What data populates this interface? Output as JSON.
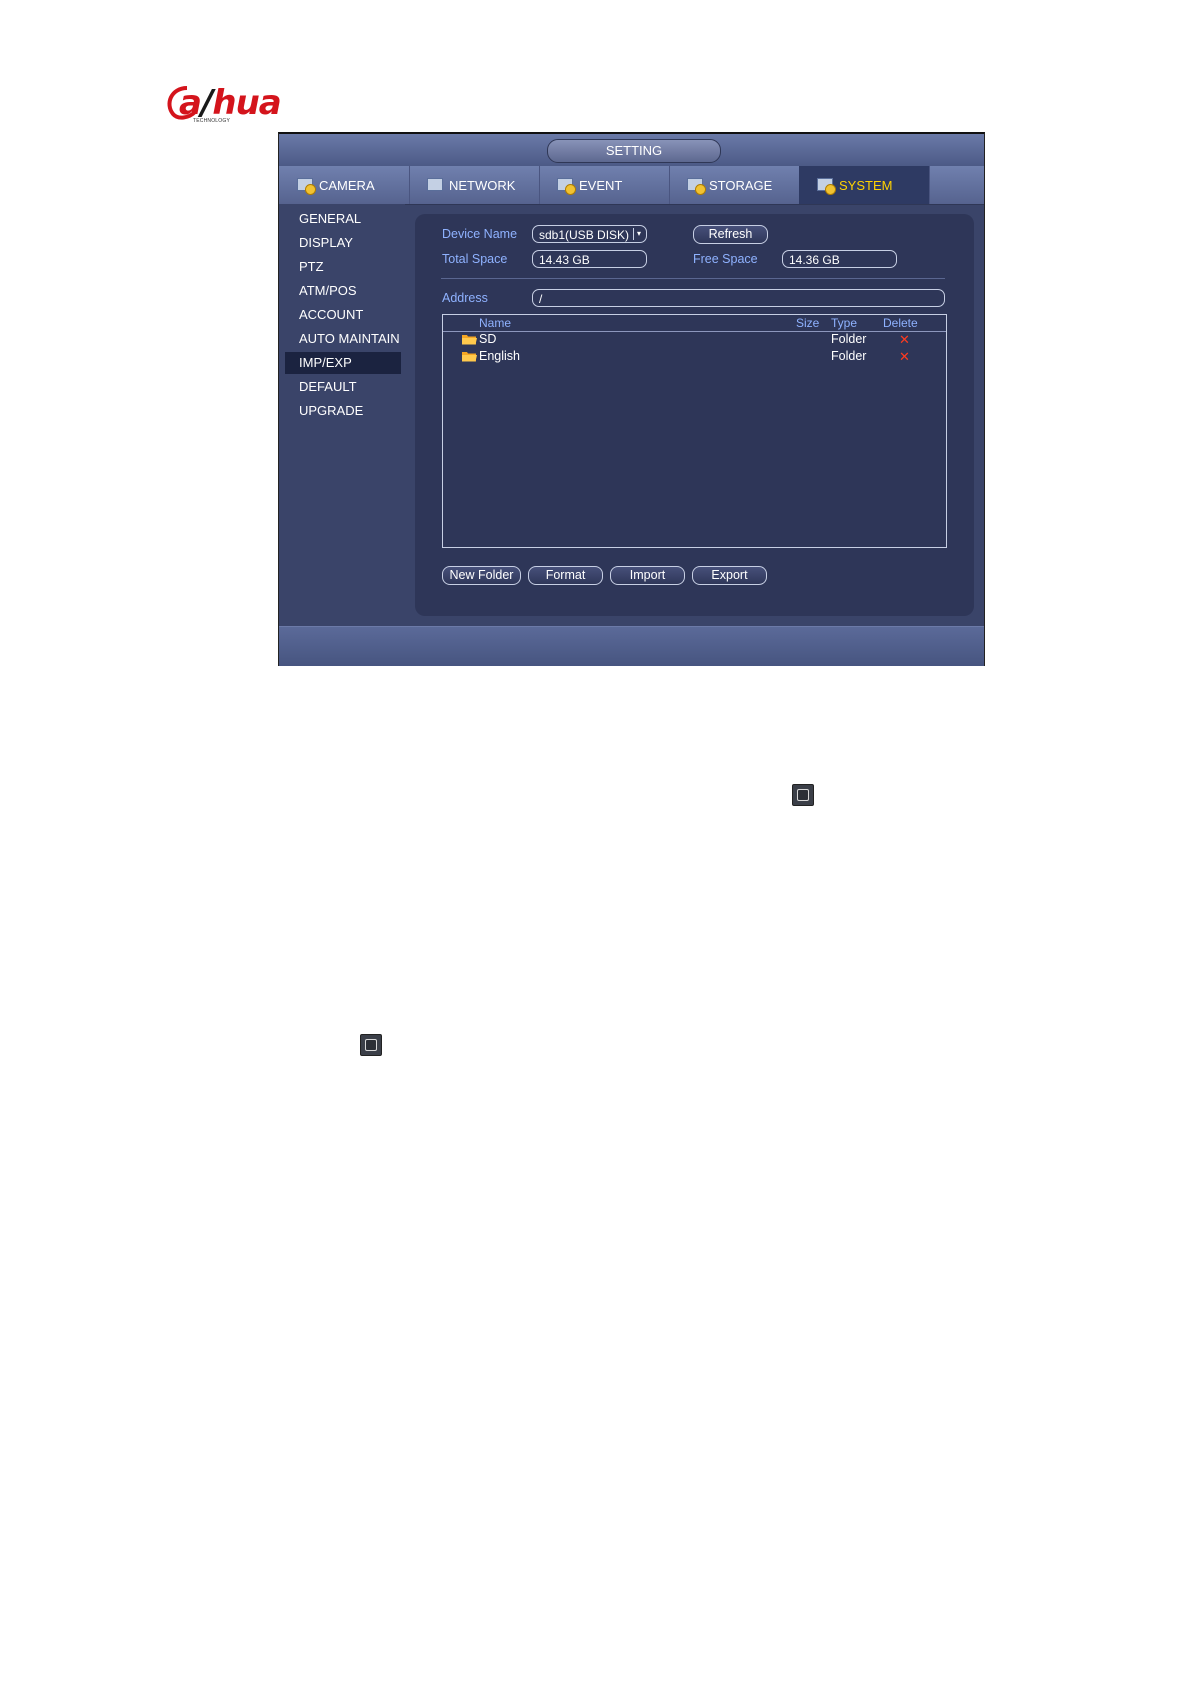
{
  "logo": {
    "brand": "alhua",
    "sub": "TECHNOLOGY"
  },
  "window": {
    "title": "SETTING"
  },
  "tabs": [
    {
      "label": "CAMERA",
      "icon": "camera-icon",
      "active": false
    },
    {
      "label": "NETWORK",
      "icon": "network-icon",
      "active": false
    },
    {
      "label": "EVENT",
      "icon": "event-icon",
      "active": false
    },
    {
      "label": "STORAGE",
      "icon": "storage-icon",
      "active": false
    },
    {
      "label": "SYSTEM",
      "icon": "system-icon",
      "active": true
    }
  ],
  "sidebar": {
    "items": [
      {
        "label": "GENERAL"
      },
      {
        "label": "DISPLAY"
      },
      {
        "label": "PTZ"
      },
      {
        "label": "ATM/POS"
      },
      {
        "label": "ACCOUNT"
      },
      {
        "label": "AUTO MAINTAIN"
      },
      {
        "label": "IMP/EXP",
        "active": true
      },
      {
        "label": "DEFAULT"
      },
      {
        "label": "UPGRADE"
      }
    ]
  },
  "device": {
    "name_label": "Device Name",
    "name_value": "sdb1(USB DISK)",
    "refresh_label": "Refresh",
    "total_label": "Total Space",
    "total_value": "14.43 GB",
    "free_label": "Free Space",
    "free_value": "14.36 GB",
    "address_label": "Address",
    "address_value": "/"
  },
  "files": {
    "headers": {
      "name": "Name",
      "size": "Size",
      "type": "Type",
      "delete": "Delete"
    },
    "rows": [
      {
        "name": "SD",
        "size": "",
        "type": "Folder"
      },
      {
        "name": "English",
        "size": "",
        "type": "Folder"
      }
    ]
  },
  "actions": {
    "new_folder": "New Folder",
    "format": "Format",
    "import": "Import",
    "export": "Export"
  },
  "colors": {
    "accent": "#ffd200",
    "label": "#8fb2ff",
    "panel": "#2e3658",
    "delete": "#ff3b1f"
  }
}
